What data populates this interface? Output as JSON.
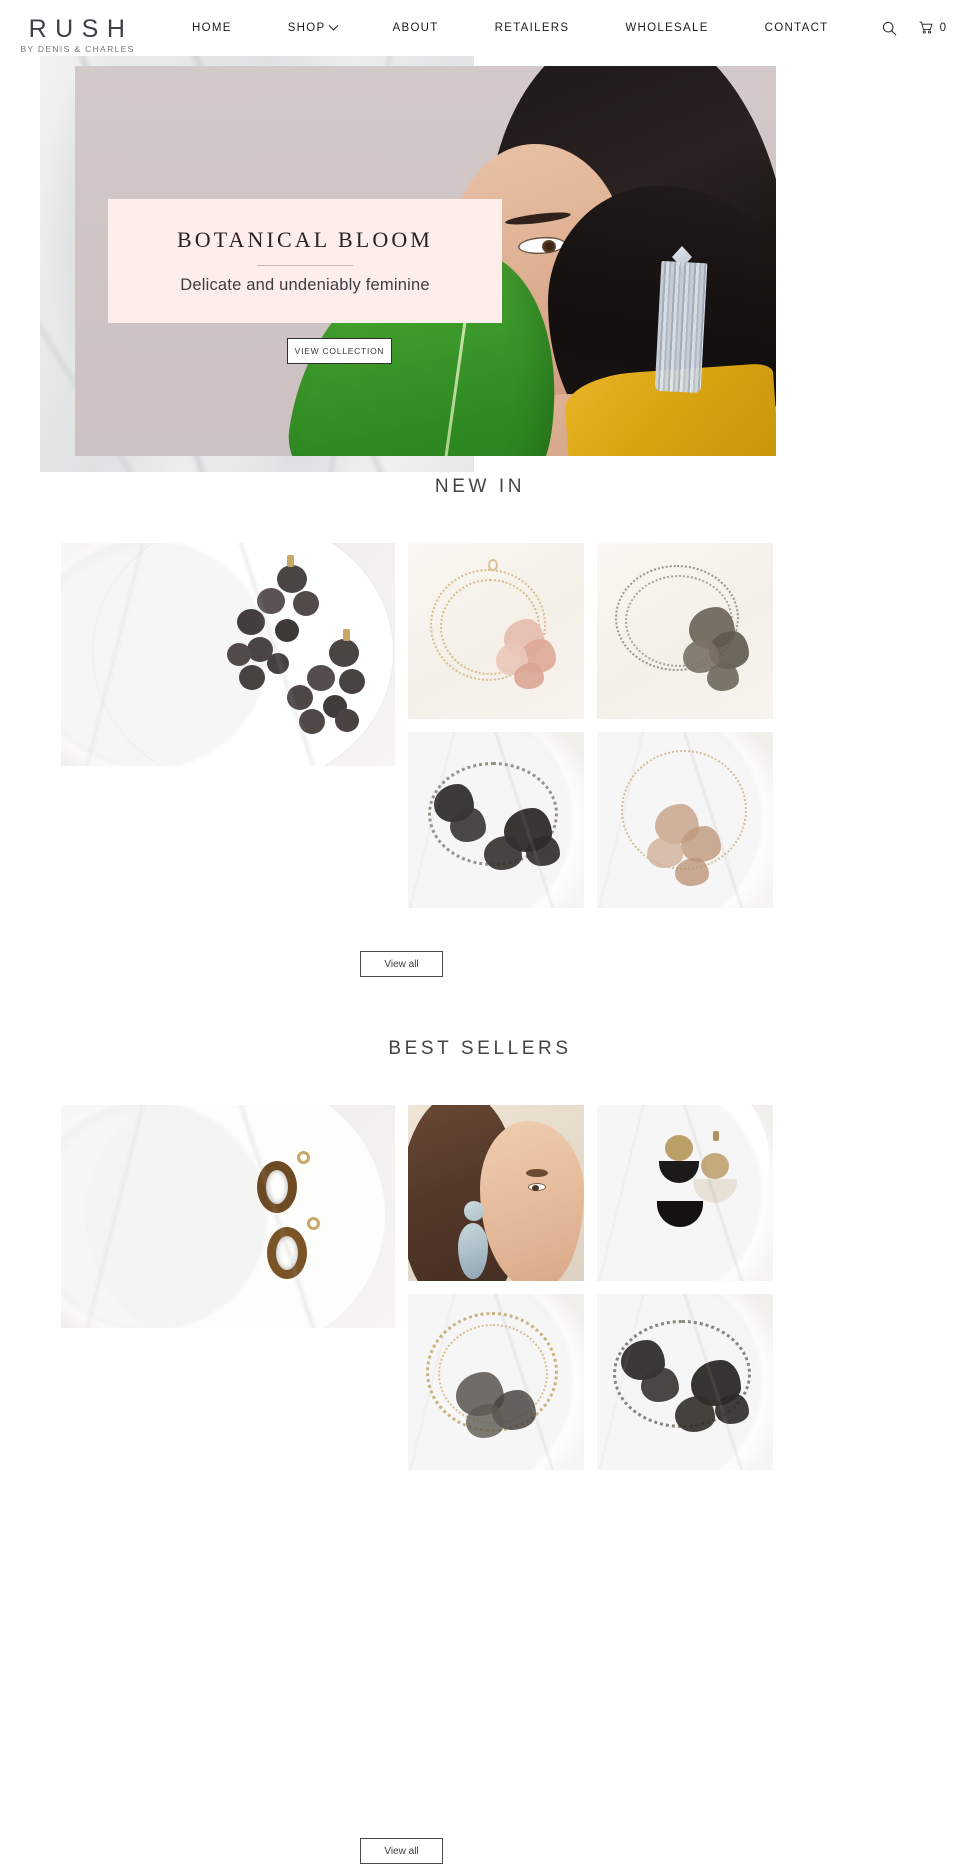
{
  "site": {
    "logo_main": "RUSH",
    "logo_sub": "BY DENIS & CHARLES"
  },
  "nav": {
    "items": [
      {
        "label": "HOME",
        "has_dropdown": false
      },
      {
        "label": "SHOP",
        "has_dropdown": true
      },
      {
        "label": "ABOUT",
        "has_dropdown": false
      },
      {
        "label": "RETAILERS",
        "has_dropdown": false
      },
      {
        "label": "WHOLESALE",
        "has_dropdown": false
      },
      {
        "label": "CONTACT",
        "has_dropdown": false
      }
    ],
    "search_icon": "search-icon",
    "cart_icon": "cart-icon",
    "cart_count": "0"
  },
  "hero": {
    "title": "BOTANICAL BLOOM",
    "subtitle": "Delicate and undeniably feminine",
    "button_label": "VIEW COLLECTION",
    "card_bg": "#fdeeec",
    "backdrop_color": "#d2c7c7",
    "image_alt": "Model holding a green leaf wearing beaded fringe earrings"
  },
  "sections": [
    {
      "id": "new-in",
      "title": "NEW IN",
      "view_all_label": "View all",
      "products": [
        {
          "alt": "Black flower cluster drop earrings on marble plate"
        },
        {
          "alt": "Gold beaded necklace with blush pink organza flowers"
        },
        {
          "alt": "Dark grey beaded necklace with charcoal organza flowers"
        },
        {
          "alt": "Black organza flower and bead necklace on marble"
        },
        {
          "alt": "Champagne beaded necklace with blush organza flowers"
        }
      ]
    },
    {
      "id": "best-sellers",
      "title": "BEST SELLERS",
      "view_all_label": "View all",
      "products": [
        {
          "alt": "Tortoise shell oval hoop earrings on marble plate"
        },
        {
          "alt": "Model wearing pale blue marbled statement earrings"
        },
        {
          "alt": "Black and cream half-moon drop earrings on marble"
        },
        {
          "alt": "Gold chain necklace with smoky organza flowers"
        },
        {
          "alt": "Charcoal beaded necklace with black organza flowers"
        }
      ]
    }
  ],
  "colors": {
    "accent_pink": "#fdeeec",
    "hero_mauve": "#d2c7c7",
    "text_dark": "#3c3c3c",
    "border": "#2d2d2d"
  }
}
